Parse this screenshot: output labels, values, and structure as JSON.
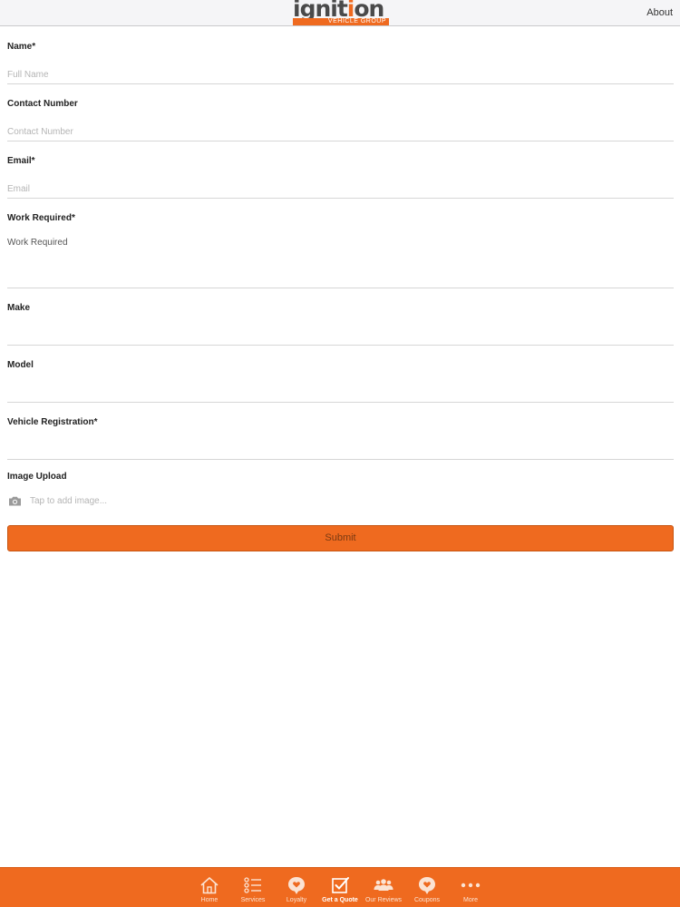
{
  "header": {
    "logo_main_a": "ignit",
    "logo_main_b": "i",
    "logo_main_c": "on",
    "logo_sub": "VEHICLE GROUP",
    "about_label": "About"
  },
  "form": {
    "name": {
      "label": "Name*",
      "placeholder": "Full Name",
      "value": ""
    },
    "contact": {
      "label": "Contact Number",
      "placeholder": "Contact Number",
      "value": ""
    },
    "email": {
      "label": "Email*",
      "placeholder": "Email",
      "value": ""
    },
    "work": {
      "label": "Work Required*",
      "placeholder": "Work Required",
      "value": ""
    },
    "make": {
      "label": "Make",
      "value": ""
    },
    "model": {
      "label": "Model",
      "value": ""
    },
    "registration": {
      "label": "Vehicle Registration*",
      "value": ""
    },
    "upload": {
      "label": "Image Upload",
      "hint": "Tap to add image...",
      "icon": "camera-icon"
    },
    "submit_label": "Submit"
  },
  "tabbar": {
    "active_index": 3,
    "items": [
      {
        "label": "Home",
        "icon": "home-icon"
      },
      {
        "label": "Services",
        "icon": "list-icon"
      },
      {
        "label": "Loyalty",
        "icon": "heart-bubble-icon"
      },
      {
        "label": "Get a Quote",
        "icon": "checkbox-icon"
      },
      {
        "label": "Our Reviews",
        "icon": "people-icon"
      },
      {
        "label": "Coupons",
        "icon": "heart-bubble-icon"
      },
      {
        "label": "More",
        "icon": "more-dots-icon"
      }
    ]
  },
  "colors": {
    "brand_orange": "#ef6a1f",
    "logo_grey": "#4a4a4a",
    "divider": "#d6d6d6",
    "placeholder": "#b5b5b5"
  }
}
